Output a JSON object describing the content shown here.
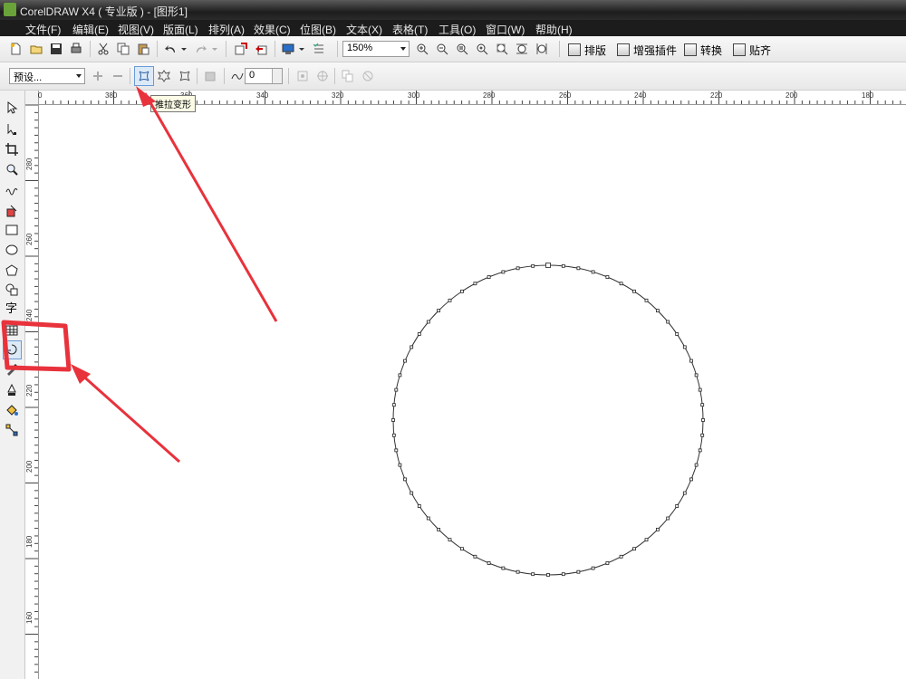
{
  "window": {
    "title": "CorelDRAW X4 ( 专业版 ) - [图形1]"
  },
  "menu": [
    "文件(F)",
    "编辑(E)",
    "视图(V)",
    "版面(L)",
    "排列(A)",
    "效果(C)",
    "位图(B)",
    "文本(X)",
    "表格(T)",
    "工具(O)",
    "窗口(W)",
    "帮助(H)"
  ],
  "toolbar": {
    "zoom_value": "150%",
    "plugins": [
      "排版",
      "增强插件",
      "转换",
      "贴齐"
    ]
  },
  "property_bar": {
    "preset_value": "预设...",
    "amplitude_value": "0"
  },
  "tooltip": "推拉变形",
  "ruler": {
    "h_labels": [
      "0",
      "380",
      "360",
      "340",
      "320",
      "300",
      "280",
      "260",
      "240",
      "220",
      "200",
      "180"
    ],
    "v_labels": [
      "280",
      "260",
      "240",
      "220",
      "200",
      "180",
      "160"
    ]
  },
  "tools": {
    "text_tool_glyph": "字"
  },
  "colors": {
    "annotation": "#e8323c",
    "titlebar": "#2a2a2a",
    "menubar": "#1c1c1c"
  }
}
